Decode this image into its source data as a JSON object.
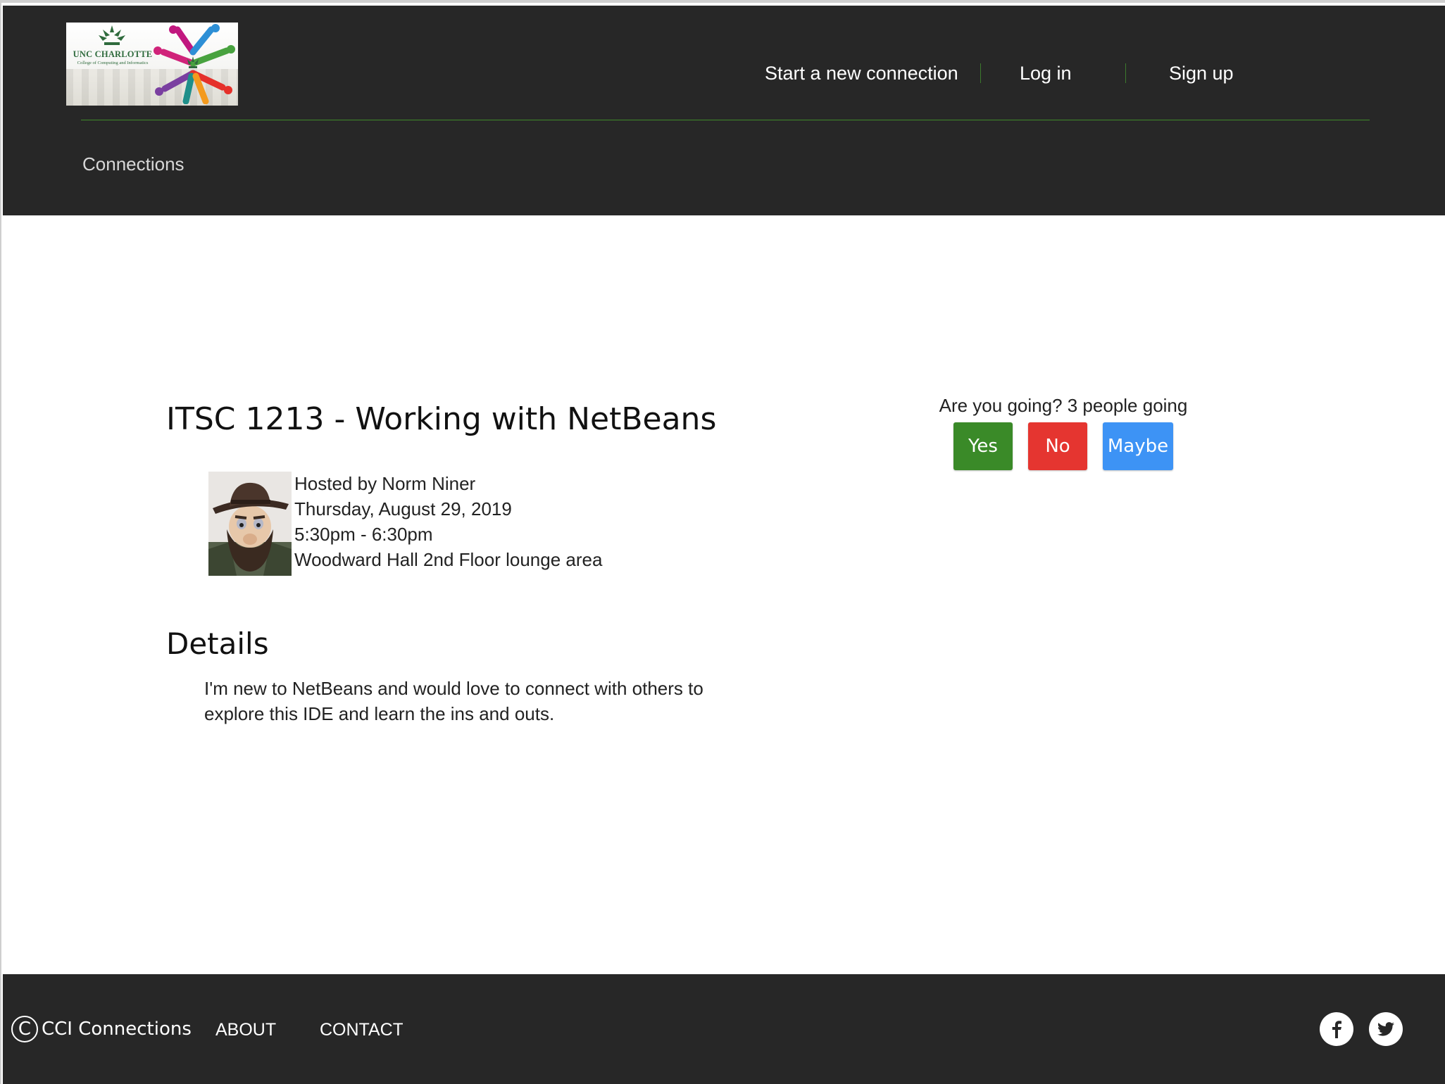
{
  "brand": {
    "logo_text_line1": "UNC CHARLOTTE",
    "logo_text_line2": "College of Computing and Informatics"
  },
  "nav": {
    "start_connection": "Start a new connection",
    "login": "Log in",
    "signup": "Sign up"
  },
  "subnav": {
    "connections": "Connections"
  },
  "event": {
    "title": "ITSC 1213 - Working with NetBeans",
    "host": "Hosted by Norm Niner",
    "date": "Thursday, August 29, 2019",
    "time": "5:30pm - 6:30pm",
    "location": "Woodward Hall 2nd Floor lounge area",
    "details_heading": "Details",
    "details_text": "I'm new to NetBeans and would love to connect with others to explore this IDE and learn the ins and outs."
  },
  "rsvp": {
    "question": "Are you going? 3 people going",
    "yes_label": "Yes",
    "no_label": "No",
    "maybe_label": "Maybe",
    "yes_color": "#3a8a28",
    "no_color": "#e53530",
    "maybe_color": "#3d93f5"
  },
  "footer": {
    "copyright_symbol": "C",
    "copyright_text": "CCI Connections",
    "about": "ABOUT",
    "contact": "CONTACT",
    "social_icons": [
      "facebook-icon",
      "twitter-icon"
    ]
  },
  "colors": {
    "header_bg": "#272727",
    "accent_green": "#3f8a2a"
  }
}
